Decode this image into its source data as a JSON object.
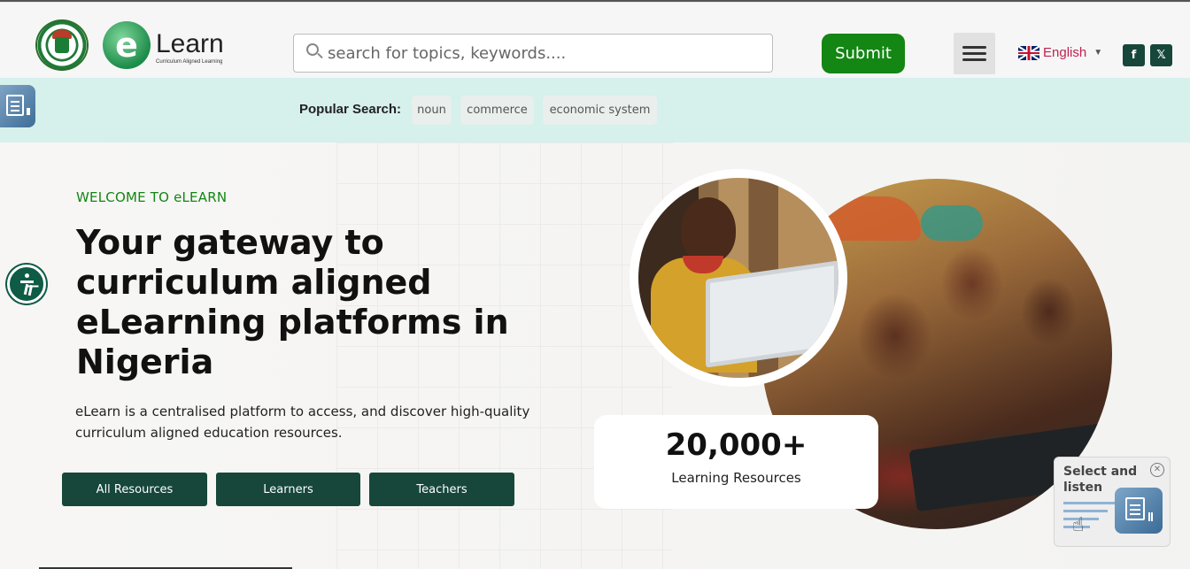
{
  "header": {
    "logo_text": "Learn",
    "logo_letter": "e",
    "logo_subtitle": "Curriculum Aligned Learning",
    "search_placeholder": "search for topics, keywords....",
    "submit_label": "Submit",
    "language": "English",
    "social": [
      "facebook-icon",
      "x-icon"
    ]
  },
  "popular": {
    "label": "Popular Search:",
    "chips": [
      "noun",
      "commerce",
      "economic system"
    ]
  },
  "hero": {
    "welcome": "WELCOME TO eLEARN",
    "headline": "Your gateway to curriculum aligned eLearning platforms in Nigeria",
    "description": "eLearn is a centralised platform to access, and discover high-quality curriculum aligned education resources.",
    "buttons": [
      "All Resources",
      "Learners",
      "Teachers"
    ],
    "stat_number": "20,000+",
    "stat_label": "Learning Resources"
  },
  "listen_widget": {
    "title": "Select and listen"
  },
  "colors": {
    "brand_green": "#138613",
    "dark_green": "#16473a",
    "popular_bar": "#d6f0ec",
    "language_red": "#c0224f"
  }
}
